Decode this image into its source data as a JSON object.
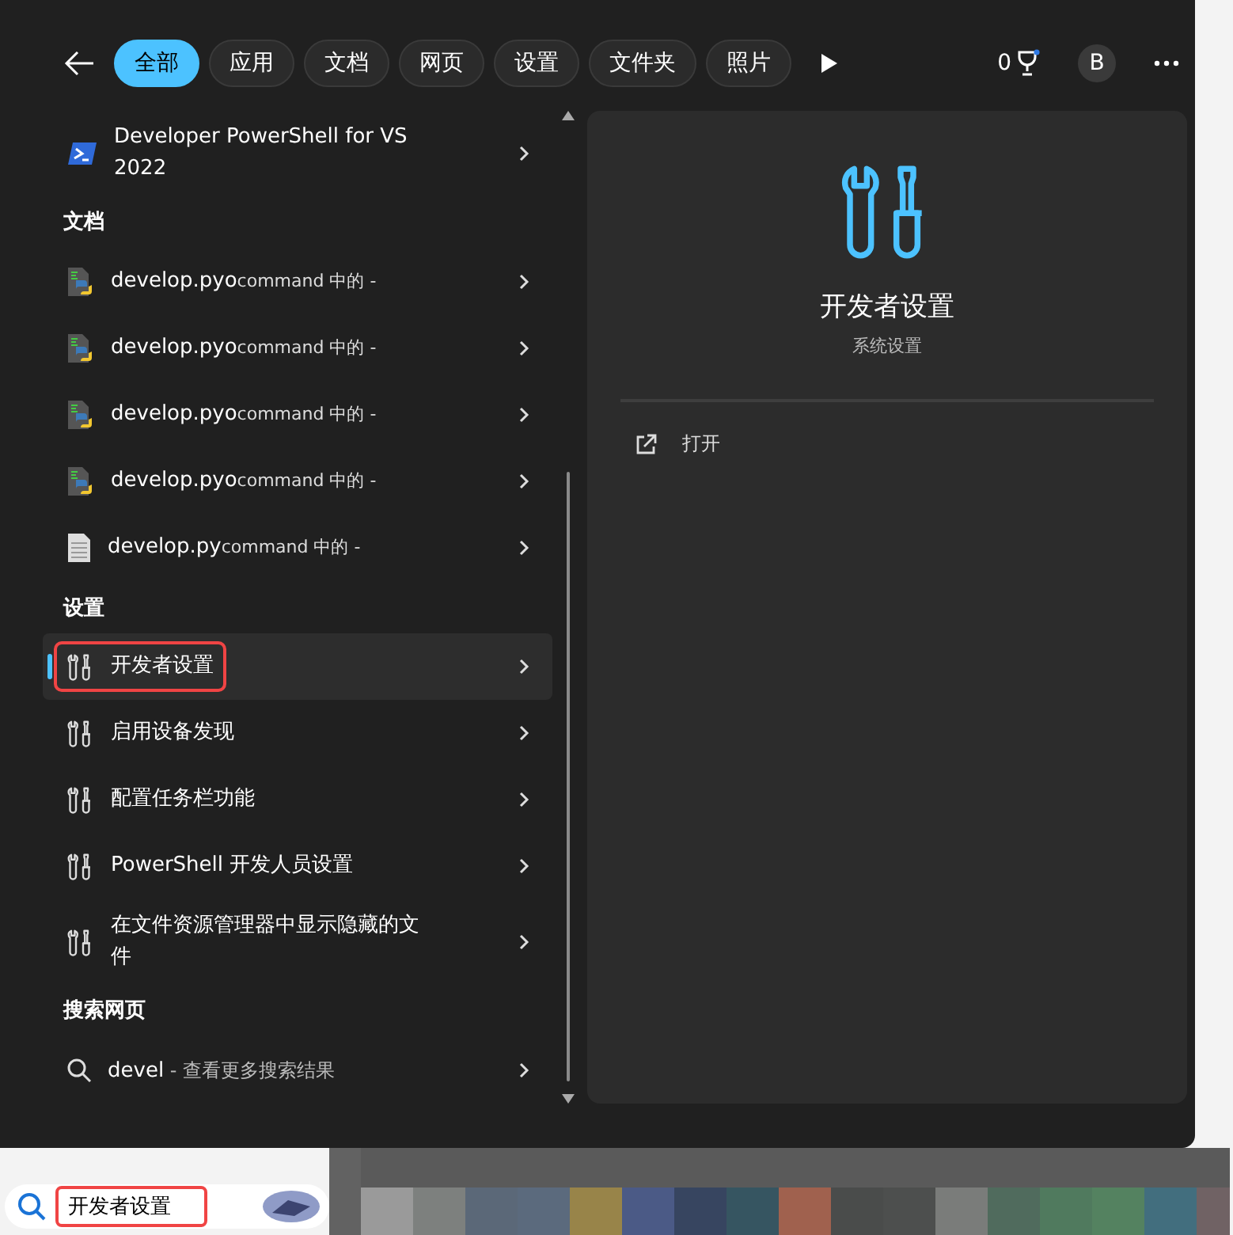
{
  "tabs": [
    {
      "label": "全部",
      "selected": true
    },
    {
      "label": "应用",
      "selected": false
    },
    {
      "label": "文档",
      "selected": false
    },
    {
      "label": "网页",
      "selected": false
    },
    {
      "label": "设置",
      "selected": false
    },
    {
      "label": "文件夹",
      "selected": false
    },
    {
      "label": "照片",
      "selected": false
    }
  ],
  "rewards_count": "0",
  "avatar": "B",
  "sections": [
    {
      "items": [
        {
          "kind": "powershell",
          "title": "Developer PowerShell for VS 2022",
          "selected": false,
          "highlighted": false
        }
      ]
    },
    {
      "heading": "文档",
      "items": [
        {
          "kind": "python",
          "title": "develop.pyo",
          "detail": "command 中的 -",
          "selected": false,
          "highlighted": false
        },
        {
          "kind": "python",
          "title": "develop.pyo",
          "detail": "command 中的 -",
          "selected": false,
          "highlighted": false
        },
        {
          "kind": "python",
          "title": "develop.pyo",
          "detail": "command 中的 -",
          "selected": false,
          "highlighted": false
        },
        {
          "kind": "python",
          "title": "develop.pyo",
          "detail": "command 中的 -",
          "selected": false,
          "highlighted": false
        },
        {
          "kind": "file",
          "title": "develop.py",
          "detail": "command 中的 -",
          "selected": false,
          "highlighted": false
        }
      ]
    },
    {
      "heading": "设置",
      "items": [
        {
          "kind": "settings",
          "title": "开发者设置",
          "selected": true,
          "highlighted": true
        },
        {
          "kind": "settings",
          "title": "启用设备发现",
          "selected": false,
          "highlighted": false
        },
        {
          "kind": "settings",
          "title": "配置任务栏功能",
          "selected": false,
          "highlighted": false
        },
        {
          "kind": "settings",
          "title": "PowerShell 开发人员设置",
          "selected": false,
          "highlighted": false
        },
        {
          "kind": "settings",
          "title": "在文件资源管理器中显示隐藏的文件",
          "selected": false,
          "highlighted": false
        }
      ]
    },
    {
      "heading": "搜索网页",
      "items": [
        {
          "kind": "search",
          "title": "devel",
          "detail": " - 查看更多搜索结果",
          "selected": false,
          "highlighted": false
        }
      ]
    }
  ],
  "preview": {
    "title": "开发者设置",
    "subtitle": "系统设置",
    "actions": [
      "打开"
    ]
  },
  "taskbar": {
    "search_value": "开发者设置",
    "highlighted": true
  }
}
